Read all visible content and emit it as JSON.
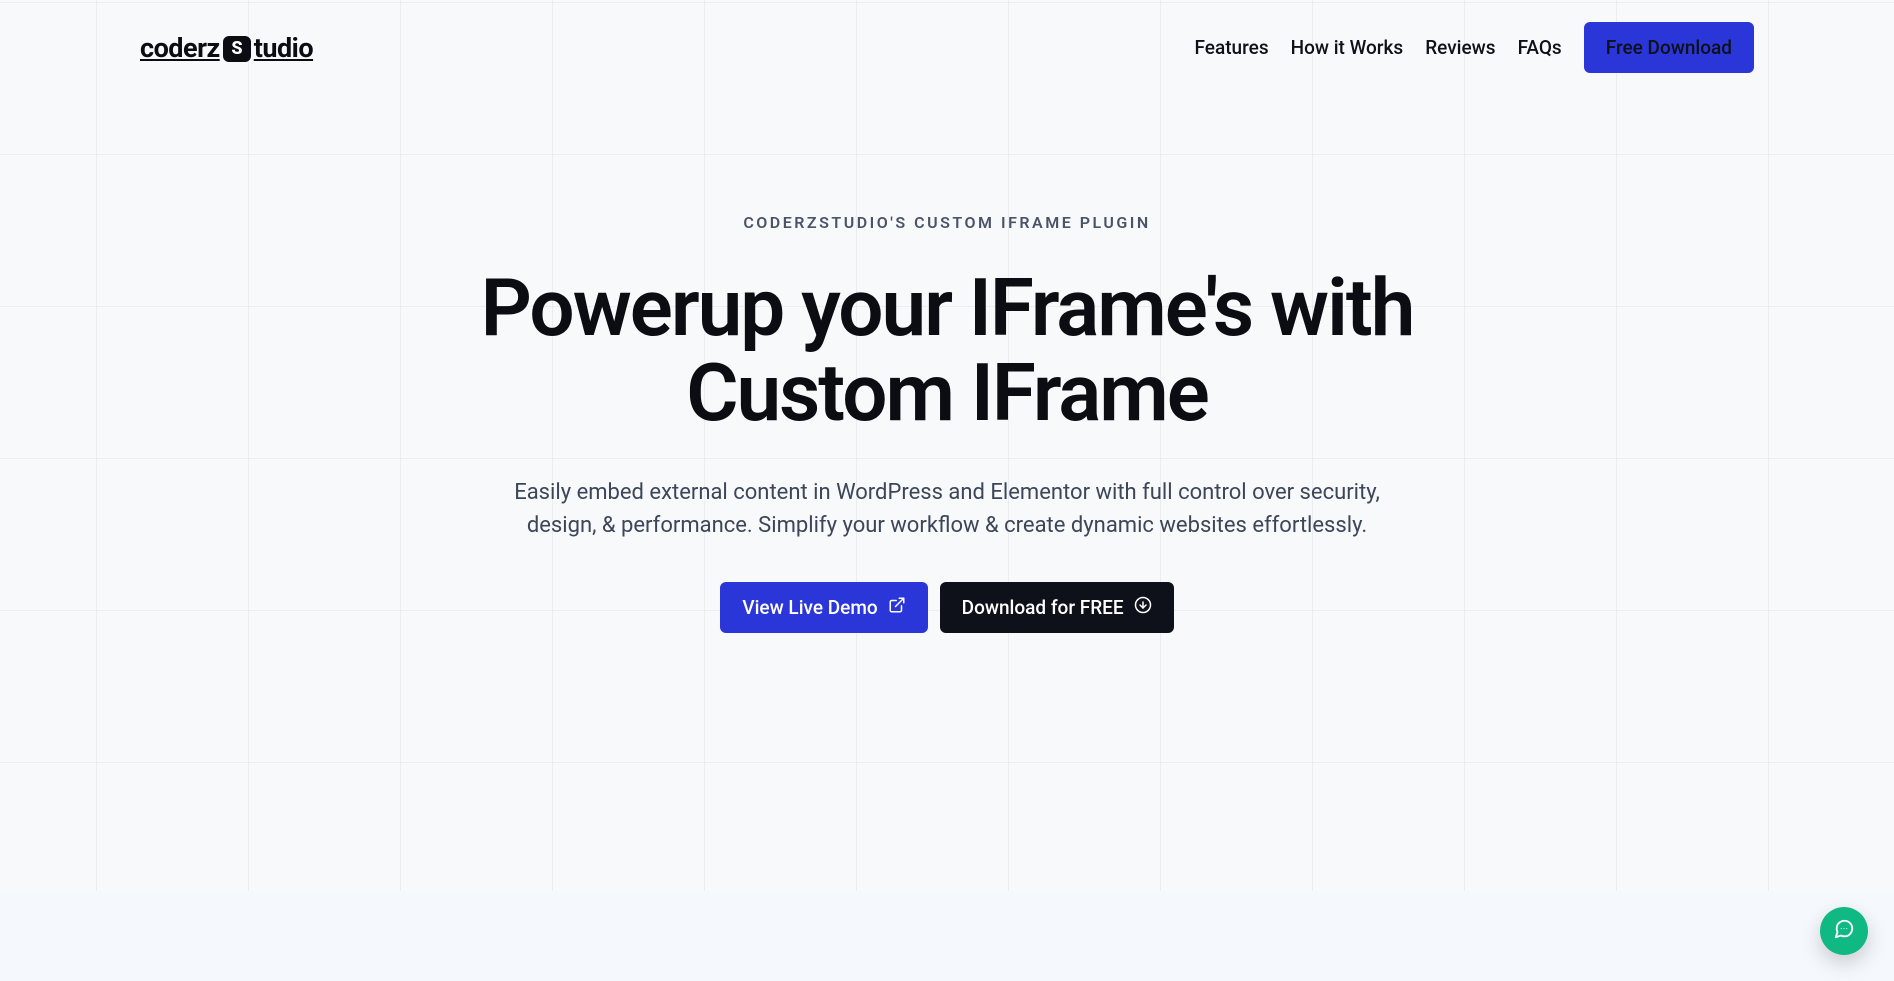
{
  "brand": {
    "name_a": "coderz",
    "name_b": "tudio",
    "badge": "S"
  },
  "nav": {
    "items": [
      {
        "label": "Features"
      },
      {
        "label": "How it Works"
      },
      {
        "label": "Reviews"
      },
      {
        "label": "FAQs"
      }
    ],
    "cta_label": "Free Download"
  },
  "hero": {
    "eyebrow": "CODERZSTUDIO'S CUSTOM IFRAME PLUGIN",
    "title": "Powerup your IFrame's with Custom IFrame",
    "subtitle": "Easily embed external content in WordPress and Elementor with full control over security, design, & performance. Simplify your workflow & create dynamic websites effortlessly.",
    "primary_cta": "View Live Demo",
    "secondary_cta": "Download for FREE"
  },
  "colors": {
    "primary": "#2b36d9",
    "dark": "#0e111a",
    "chat": "#10b981",
    "bg": "#f8f9fb"
  },
  "icons": {
    "external_link": "external-link-icon",
    "download_circle": "download-circle-icon",
    "chat": "chat-icon"
  }
}
